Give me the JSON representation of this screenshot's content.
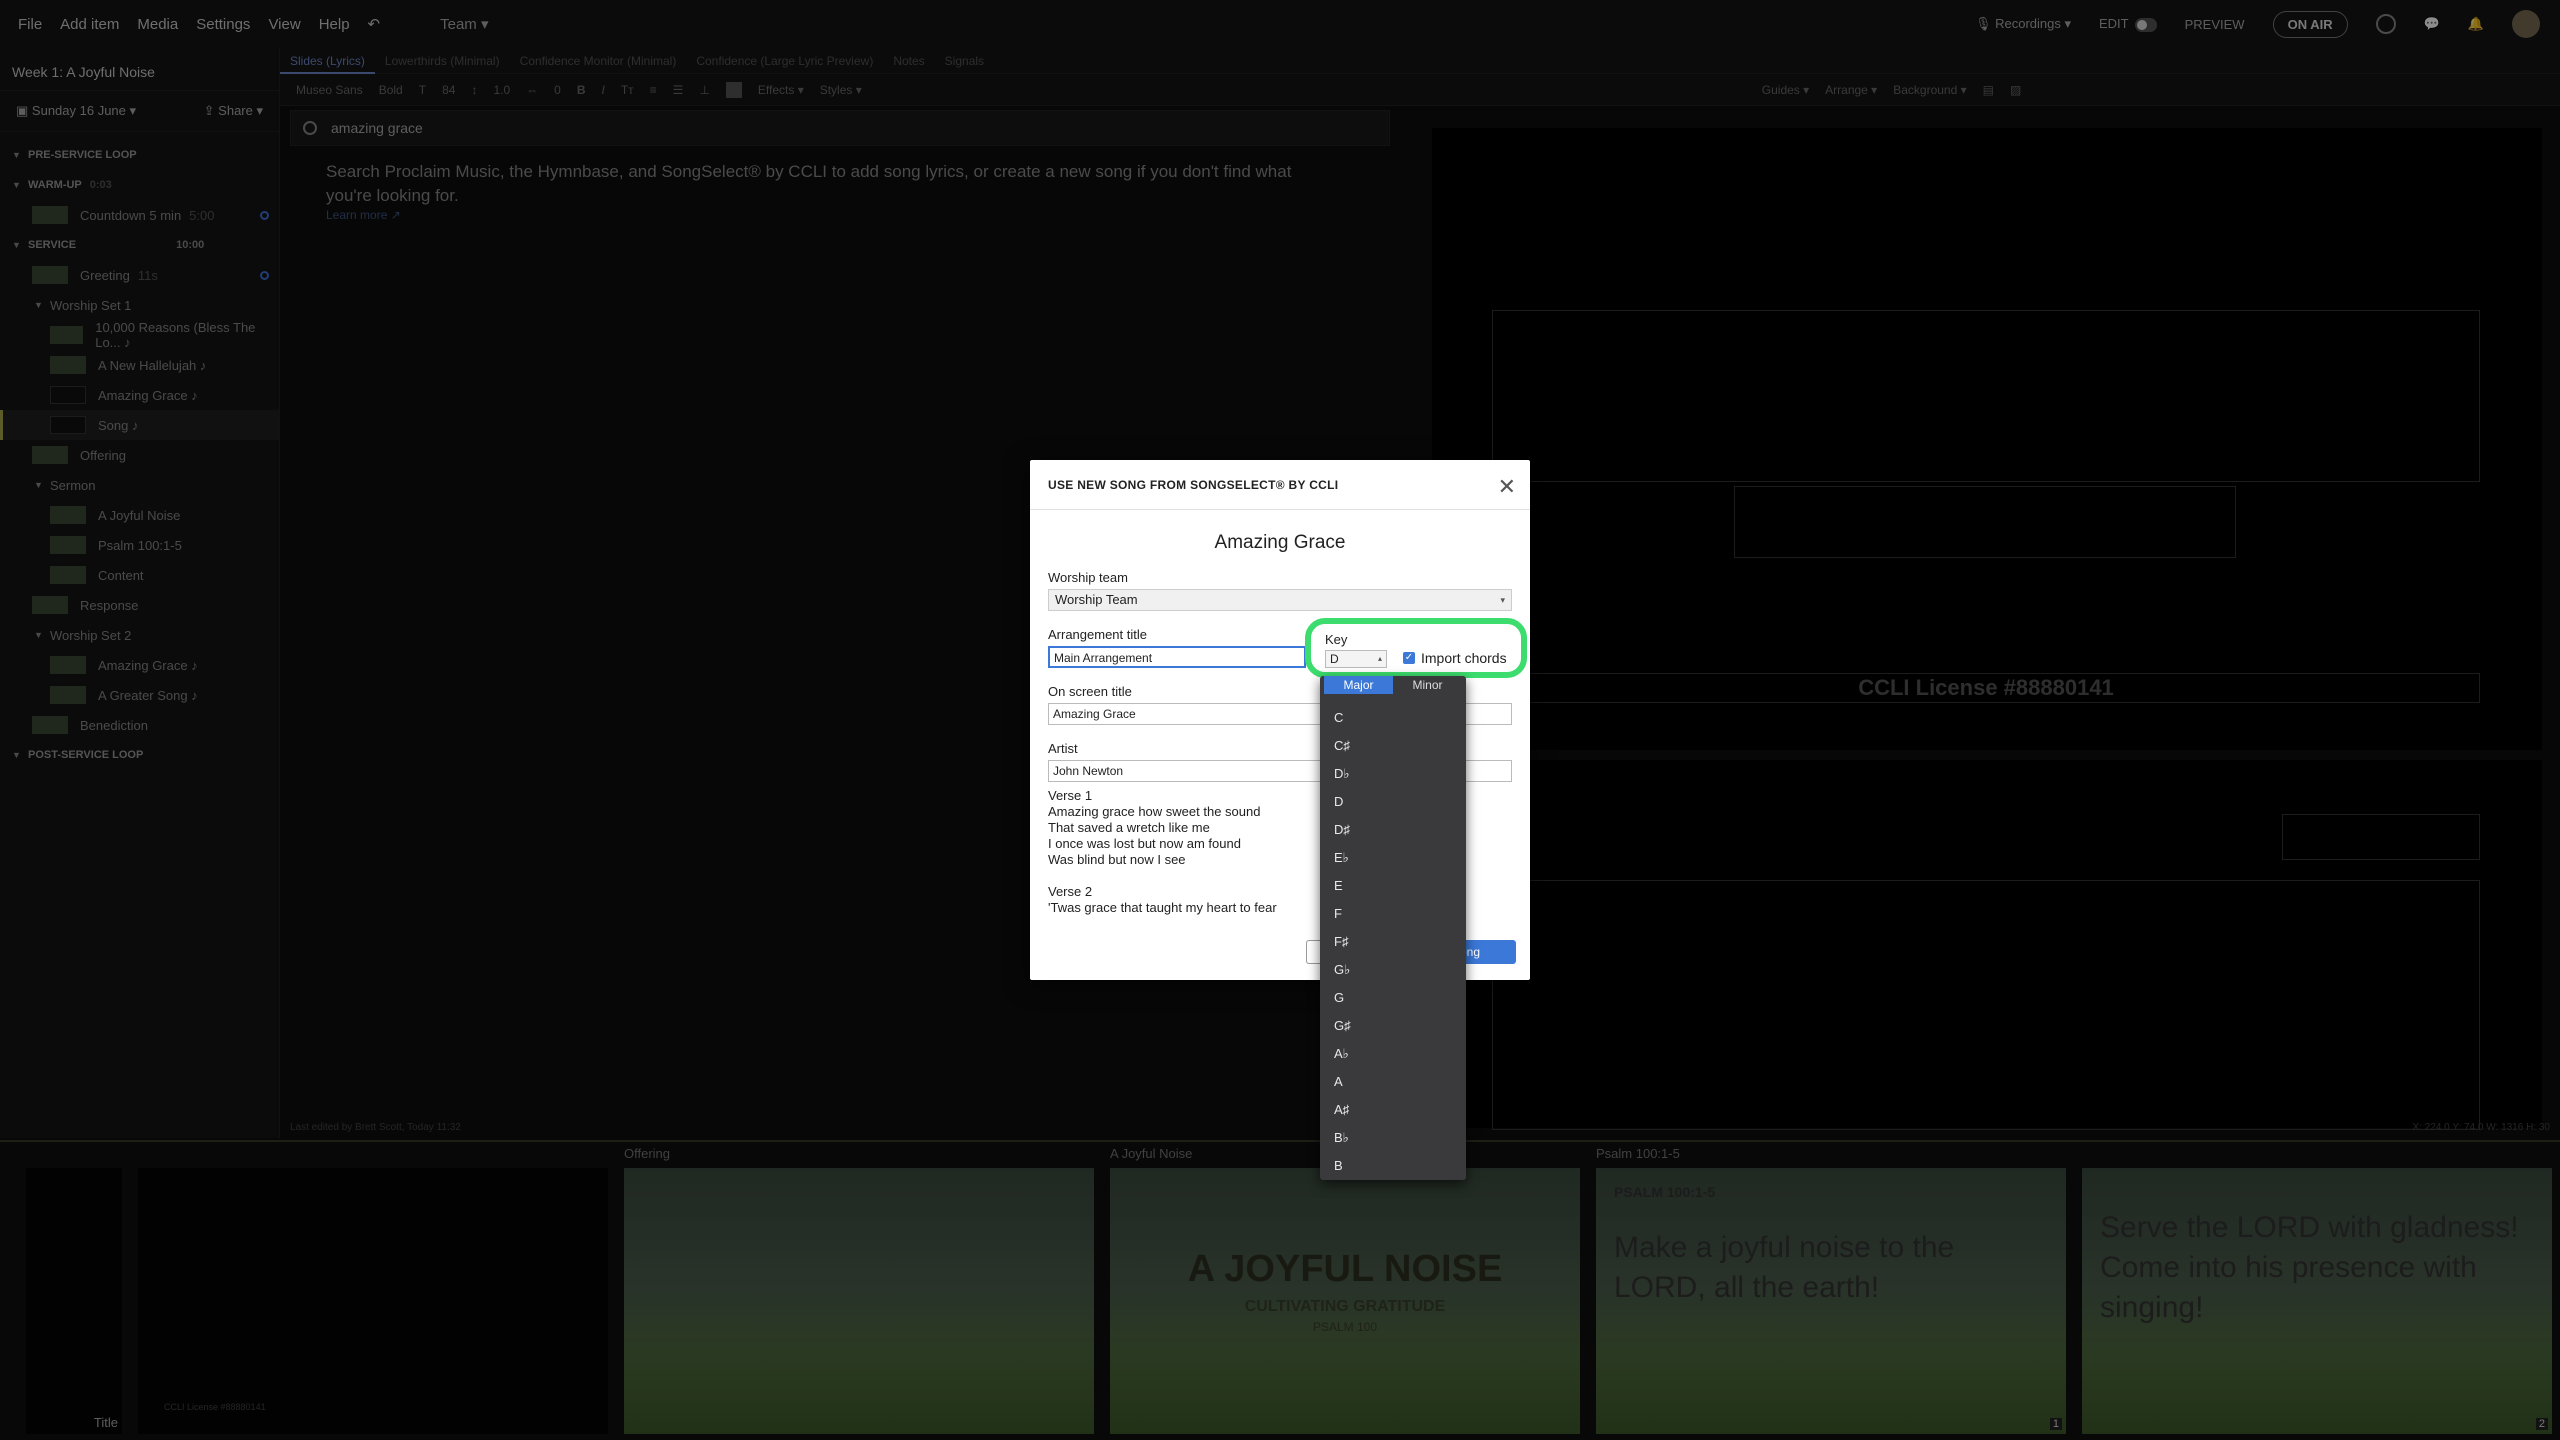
{
  "menubar": {
    "items": [
      "File",
      "Add item",
      "Media",
      "Settings",
      "View",
      "Help"
    ],
    "team": "Team ▾",
    "recordings": "Recordings ▾",
    "edit": "EDIT",
    "preview": "PREVIEW",
    "on_air": "ON AIR"
  },
  "sidebar": {
    "title": "Week 1: A Joyful Noise",
    "date": "Sunday 16 June ▾",
    "share": "Share ▾",
    "sections": {
      "pre_service": "PRE-SERVICE LOOP",
      "warm_up": "WARM-UP",
      "warm_up_time": "0:03",
      "countdown": "Countdown 5 min",
      "countdown_time": "5:00",
      "service": "SERVICE",
      "service_time": "10:00",
      "greeting": "Greeting",
      "greeting_time": "11s",
      "worship1": "Worship Set 1",
      "w1_items": [
        "10,000 Reasons (Bless The Lo... ♪",
        "A New Hallelujah ♪",
        "Amazing Grace ♪",
        "Song ♪"
      ],
      "offering": "Offering",
      "sermon": "Sermon",
      "sermon_items": [
        "A Joyful Noise",
        "Psalm 100:1-5",
        "Content"
      ],
      "response": "Response",
      "worship2": "Worship Set 2",
      "w2_items": [
        "Amazing Grace ♪",
        "A Greater Song ♪"
      ],
      "benediction": "Benediction",
      "post_service": "POST-SERVICE LOOP"
    }
  },
  "tabs": [
    "Slides (Lyrics)",
    "Lowerthirds (Minimal)",
    "Confidence Monitor (Minimal)",
    "Confidence (Large Lyric Preview)",
    "Notes",
    "Signals"
  ],
  "toolbar": {
    "font": "Museo Sans",
    "weight": "Bold",
    "size": "84",
    "line": "1.0",
    "spacing": "0",
    "effects": "Effects ▾",
    "styles": "Styles ▾",
    "guides": "Guides ▾",
    "arrange": "Arrange ▾",
    "background": "Background ▾"
  },
  "editor": {
    "search_value": "amazing grace",
    "help": "Search Proclaim Music, the Hymnbase, and SongSelect® by CCLI to add song lyrics, or create a new song if you don't find what you're looking for.",
    "learn_more": "Learn more ↗"
  },
  "preview": {
    "ccli": "CCLI License #88880141"
  },
  "status": {
    "last_edited": "Last edited by Brett Scott, Today 11:32",
    "coords": "X: 224.0  Y: 74.0     W: 1316  H: 30"
  },
  "strip": {
    "labels": [
      "Offering",
      "A Joyful Noise",
      "Psalm 100:1-5"
    ],
    "first_title": "Title",
    "first_ccli": "CCLI License #88880141",
    "joy_title": "A JOYFUL NOISE",
    "joy_sub": "CULTIVATING GRATITUDE",
    "joy_psalm": "PSALM 100",
    "psalm_ref": "PSALM 100:1-5",
    "psalm_text": "Make a joyful noise to the LORD, all the earth!",
    "serve_text": "Serve the LORD with gladness! Come into his presence with singing!",
    "badge1": "1",
    "badge2": "2"
  },
  "modal": {
    "header": "USE NEW SONG FROM SONGSELECT® BY CCLI",
    "song_title": "Amazing Grace",
    "worship_team_label": "Worship team",
    "worship_team_value": "Worship Team",
    "arrangement_label": "Arrangement title",
    "arrangement_value": "Main Arrangement",
    "onscreen_label": "On screen title",
    "onscreen_value": "Amazing Grace",
    "artist_label": "Artist",
    "artist_value": "John Newton",
    "lyrics": "Verse 1\nAmazing grace how sweet the sound\nThat saved a wretch like me\nI once was lost but now am found\nWas blind but now I see\n\nVerse 2\n'Twas grace that taught my heart to fear",
    "add_button": "Song",
    "key_label": "Key",
    "key_value": "D",
    "import_chords": "Import chords",
    "mode_major": "Major",
    "mode_minor": "Minor",
    "keys": [
      "C",
      "C♯",
      "D♭",
      "D",
      "D♯",
      "E♭",
      "E",
      "F",
      "F♯",
      "G♭",
      "G",
      "G♯",
      "A♭",
      "A",
      "A♯",
      "B♭",
      "B"
    ]
  },
  "colors": {
    "highlight_ring": "#3ddc6e",
    "accent_blue": "#3b78d8"
  }
}
